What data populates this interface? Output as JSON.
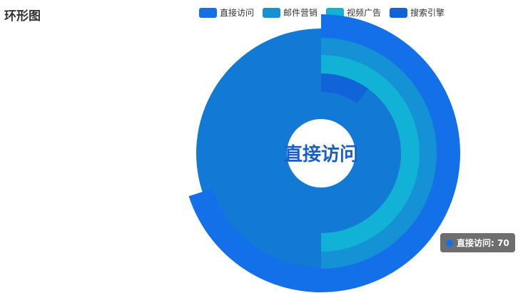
{
  "title": "环形图",
  "legend": [
    {
      "name": "直接访问",
      "color": "#1470e8"
    },
    {
      "name": "邮件营销",
      "color": "#1591d6"
    },
    {
      "name": "视频广告",
      "color": "#12b2d6"
    },
    {
      "name": "搜索引擎",
      "color": "#1164d8"
    }
  ],
  "center_label": "直接访问",
  "tooltip": {
    "text": "直接访问: 70",
    "color": "#1470e8"
  },
  "chart_data": {
    "type": "pie",
    "subtype": "concentric-rings",
    "angle_max": 100,
    "series": [
      {
        "name": "直接访问",
        "value": 70,
        "color": "#1470e8",
        "highlighted": true
      },
      {
        "name": "邮件营销",
        "value": 50,
        "color": "#1591d6"
      },
      {
        "name": "视频广告",
        "value": 50,
        "color": "#12b2d6"
      },
      {
        "name": "搜索引擎",
        "value": 10,
        "color": "#1164d8"
      }
    ],
    "track_color": "#127ad4"
  }
}
